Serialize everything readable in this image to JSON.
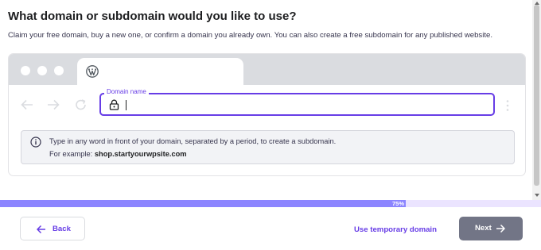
{
  "header": {
    "title": "What domain or subdomain would you like to use?",
    "subtitle": "Claim your free domain, buy a new one, or confirm a domain you already own. You can also create a free subdomain for any published website."
  },
  "browser": {
    "tab_icon": "wordpress-icon",
    "nav_icons": [
      "back-arrow-icon",
      "forward-arrow-icon",
      "reload-icon"
    ],
    "menu_icon": "kebab-icon"
  },
  "domain_field": {
    "label": "Domain name",
    "value": "",
    "icon": "lock-icon"
  },
  "info": {
    "icon": "info-icon",
    "line1": "Type in any word in front of your domain, separated by a period, to create a subdomain.",
    "example_prefix": "For example:",
    "example_value": "shop.startyourwpsite.com"
  },
  "progress": {
    "value": 0.75,
    "label": "75%"
  },
  "footer": {
    "back_label": "Back",
    "temp_domain_label": "Use temporary domain",
    "next_label": "Next"
  },
  "colors": {
    "accent": "#673de6",
    "progress_fill": "#8c85ff",
    "progress_track": "#ebe4ff",
    "next_button": "#727586",
    "info_background": "#f2f3f6"
  }
}
